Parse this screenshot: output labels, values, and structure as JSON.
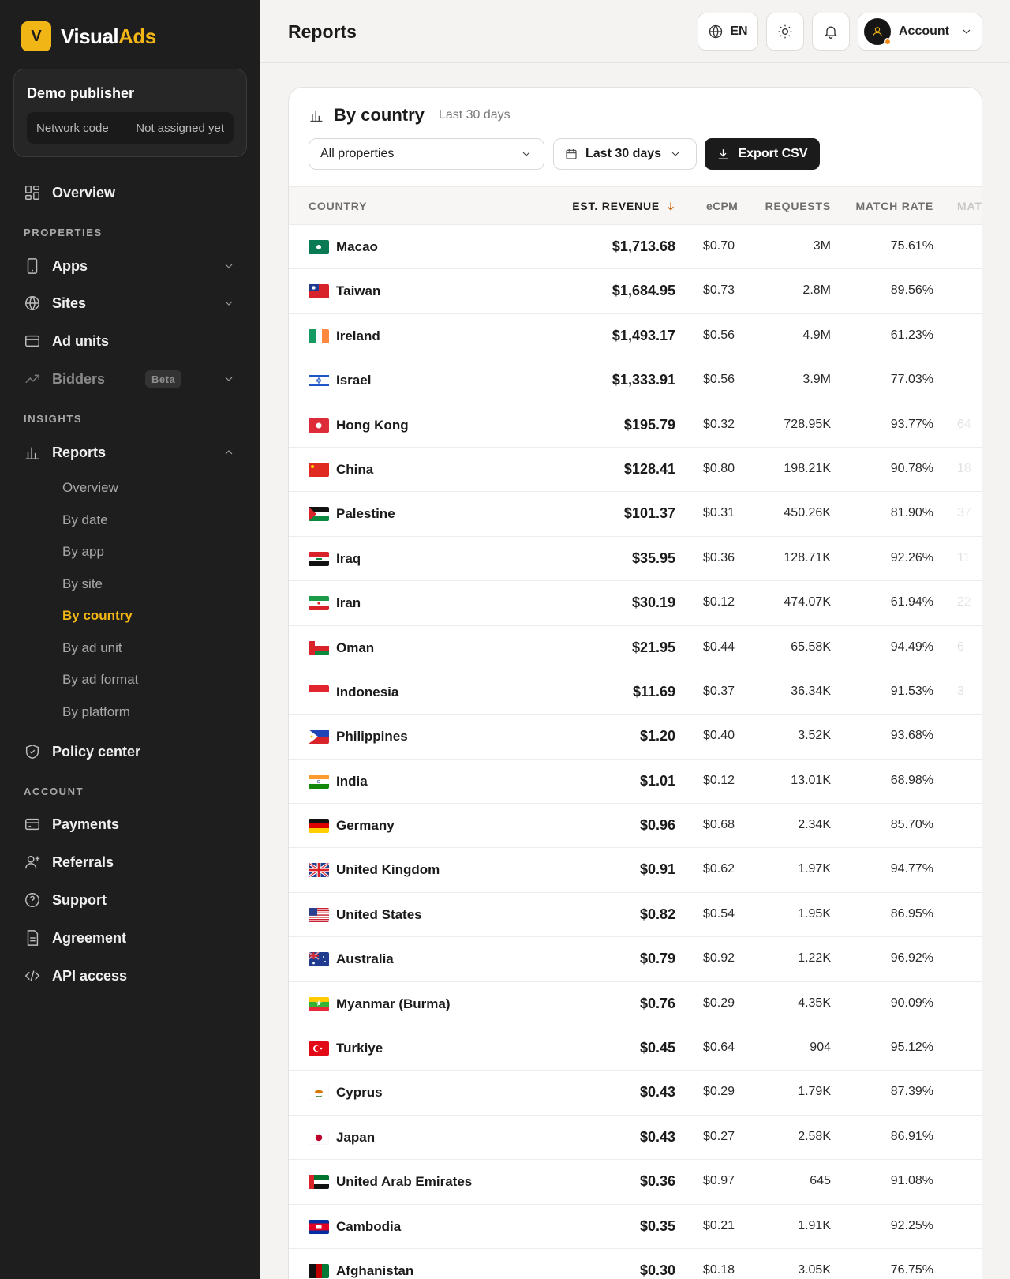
{
  "brand": {
    "mark": "V",
    "name_part1": "Visual",
    "name_part2": "Ads"
  },
  "publisher": {
    "name": "Demo publisher",
    "code_label": "Network code",
    "code_value": "Not assigned yet"
  },
  "sidebar": {
    "overview": "Overview",
    "properties_label": "PROPERTIES",
    "apps": "Apps",
    "sites": "Sites",
    "ad_units": "Ad units",
    "bidders": "Bidders",
    "bidders_badge": "Beta",
    "insights_label": "INSIGHTS",
    "reports": "Reports",
    "reports_sub": [
      "Overview",
      "By date",
      "By app",
      "By site",
      "By country",
      "By ad unit",
      "By ad format",
      "By platform"
    ],
    "policy_center": "Policy center",
    "account_label": "ACCOUNT",
    "payments": "Payments",
    "referrals": "Referrals",
    "support": "Support",
    "agreement": "Agreement",
    "api_access": "API access"
  },
  "header": {
    "title": "Reports",
    "lang": "EN",
    "account": "Account"
  },
  "card": {
    "title": "By country",
    "subtitle": "Last 30 days",
    "property_select": "All properties",
    "date_select": "Last 30 days",
    "export": "Export CSV"
  },
  "table": {
    "columns": [
      "COUNTRY",
      "EST. REVENUE",
      "eCPM",
      "REQUESTS",
      "MATCH RATE",
      "MAT"
    ],
    "rows": [
      {
        "country": "Macao",
        "revenue": "$1,713.68",
        "ecpm": "$0.70",
        "requests": "3M",
        "match_rate": "75.61%",
        "extra": ""
      },
      {
        "country": "Taiwan",
        "revenue": "$1,684.95",
        "ecpm": "$0.73",
        "requests": "2.8M",
        "match_rate": "89.56%",
        "extra": ""
      },
      {
        "country": "Ireland",
        "revenue": "$1,493.17",
        "ecpm": "$0.56",
        "requests": "4.9M",
        "match_rate": "61.23%",
        "extra": ""
      },
      {
        "country": "Israel",
        "revenue": "$1,333.91",
        "ecpm": "$0.56",
        "requests": "3.9M",
        "match_rate": "77.03%",
        "extra": ""
      },
      {
        "country": "Hong Kong",
        "revenue": "$195.79",
        "ecpm": "$0.32",
        "requests": "728.95K",
        "match_rate": "93.77%",
        "extra": "64"
      },
      {
        "country": "China",
        "revenue": "$128.41",
        "ecpm": "$0.80",
        "requests": "198.21K",
        "match_rate": "90.78%",
        "extra": "18"
      },
      {
        "country": "Palestine",
        "revenue": "$101.37",
        "ecpm": "$0.31",
        "requests": "450.26K",
        "match_rate": "81.90%",
        "extra": "37"
      },
      {
        "country": "Iraq",
        "revenue": "$35.95",
        "ecpm": "$0.36",
        "requests": "128.71K",
        "match_rate": "92.26%",
        "extra": "11"
      },
      {
        "country": "Iran",
        "revenue": "$30.19",
        "ecpm": "$0.12",
        "requests": "474.07K",
        "match_rate": "61.94%",
        "extra": "22"
      },
      {
        "country": "Oman",
        "revenue": "$21.95",
        "ecpm": "$0.44",
        "requests": "65.58K",
        "match_rate": "94.49%",
        "extra": "6"
      },
      {
        "country": "Indonesia",
        "revenue": "$11.69",
        "ecpm": "$0.37",
        "requests": "36.34K",
        "match_rate": "91.53%",
        "extra": "3"
      },
      {
        "country": "Philippines",
        "revenue": "$1.20",
        "ecpm": "$0.40",
        "requests": "3.52K",
        "match_rate": "93.68%",
        "extra": ""
      },
      {
        "country": "India",
        "revenue": "$1.01",
        "ecpm": "$0.12",
        "requests": "13.01K",
        "match_rate": "68.98%",
        "extra": ""
      },
      {
        "country": "Germany",
        "revenue": "$0.96",
        "ecpm": "$0.68",
        "requests": "2.34K",
        "match_rate": "85.70%",
        "extra": ""
      },
      {
        "country": "United Kingdom",
        "revenue": "$0.91",
        "ecpm": "$0.62",
        "requests": "1.97K",
        "match_rate": "94.77%",
        "extra": ""
      },
      {
        "country": "United States",
        "revenue": "$0.82",
        "ecpm": "$0.54",
        "requests": "1.95K",
        "match_rate": "86.95%",
        "extra": ""
      },
      {
        "country": "Australia",
        "revenue": "$0.79",
        "ecpm": "$0.92",
        "requests": "1.22K",
        "match_rate": "96.92%",
        "extra": ""
      },
      {
        "country": "Myanmar (Burma)",
        "revenue": "$0.76",
        "ecpm": "$0.29",
        "requests": "4.35K",
        "match_rate": "90.09%",
        "extra": ""
      },
      {
        "country": "Turkiye",
        "revenue": "$0.45",
        "ecpm": "$0.64",
        "requests": "904",
        "match_rate": "95.12%",
        "extra": ""
      },
      {
        "country": "Cyprus",
        "revenue": "$0.43",
        "ecpm": "$0.29",
        "requests": "1.79K",
        "match_rate": "87.39%",
        "extra": ""
      },
      {
        "country": "Japan",
        "revenue": "$0.43",
        "ecpm": "$0.27",
        "requests": "2.58K",
        "match_rate": "86.91%",
        "extra": ""
      },
      {
        "country": "United Arab Emirates",
        "revenue": "$0.36",
        "ecpm": "$0.97",
        "requests": "645",
        "match_rate": "91.08%",
        "extra": ""
      },
      {
        "country": "Cambodia",
        "revenue": "$0.35",
        "ecpm": "$0.21",
        "requests": "1.91K",
        "match_rate": "92.25%",
        "extra": ""
      },
      {
        "country": "Afghanistan",
        "revenue": "$0.30",
        "ecpm": "$0.18",
        "requests": "3.05K",
        "match_rate": "76.75%",
        "extra": ""
      }
    ]
  },
  "colors": {
    "accent": "#f2b516",
    "sidebar_bg": "#1e1e1e",
    "export_bg": "#1b1b1b"
  }
}
